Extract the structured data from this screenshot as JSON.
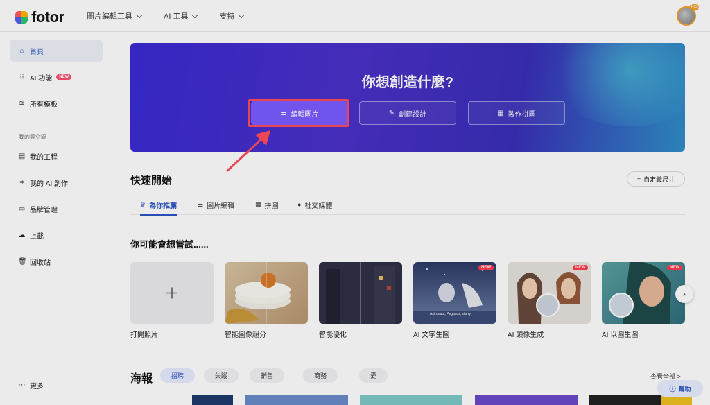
{
  "header": {
    "logo_text": "fotor",
    "nav": [
      {
        "label": "圖片編輯工具"
      },
      {
        "label": "AI 工具"
      },
      {
        "label": "支持"
      }
    ],
    "avatar_badge": "Pro"
  },
  "sidebar": {
    "items": [
      {
        "label": "首頁",
        "icon": "home-icon"
      },
      {
        "label": "AI 功能",
        "icon": "grid-icon",
        "badge": "NEW"
      },
      {
        "label": "所有模板",
        "icon": "layers-icon"
      }
    ],
    "section_title": "我的雲空間",
    "space_items": [
      {
        "label": "我的工程",
        "icon": "document-icon"
      },
      {
        "label": "我的 AI 創作",
        "icon": "frame-icon"
      },
      {
        "label": "品牌管理",
        "icon": "brand-icon"
      },
      {
        "label": "上載",
        "icon": "upload-cloud-icon"
      },
      {
        "label": "回收站",
        "icon": "trash-icon"
      }
    ],
    "more": "更多"
  },
  "hero": {
    "title": "你想創造什麼?",
    "buttons": [
      {
        "label": "編輯圖片",
        "icon": "sliders-icon"
      },
      {
        "label": "創建設計",
        "icon": "magic-wand-icon"
      },
      {
        "label": "製作拼圖",
        "icon": "collage-icon"
      }
    ]
  },
  "quick_start": {
    "title": "快速開始",
    "custom_size": "自定義尺寸",
    "tabs": [
      {
        "label": "為你推薦",
        "icon": "recommend-icon"
      },
      {
        "label": "圖片編輯",
        "icon": "sliders-icon"
      },
      {
        "label": "拼圖",
        "icon": "collage-icon"
      },
      {
        "label": "社交媒體",
        "icon": "chat-icon"
      }
    ]
  },
  "suggestions": {
    "title": "你可能會想嘗試......",
    "cards": [
      {
        "label": "打開照片"
      },
      {
        "label": "智能圖像超分"
      },
      {
        "label": "智能優化"
      },
      {
        "label": "AI 文字生圖",
        "new": "NEW",
        "caption": "Astronaut, Pegasus, starry"
      },
      {
        "label": "AI 頭像生成",
        "new": "NEW"
      },
      {
        "label": "AI 以圖生圖",
        "new": "NEW"
      }
    ]
  },
  "posters": {
    "title": "海報",
    "chips": [
      "招聘",
      "失蹤",
      "銷售",
      "商務",
      "愛"
    ],
    "view_all": "查看全部 >"
  },
  "help": "幫助",
  "colors": {
    "accent": "#2b55c4",
    "hero_start": "#3a2bd4",
    "primary_button": "#7b5cff",
    "highlight": "#ff4d5a",
    "new_badge": "#ff3b4d"
  }
}
